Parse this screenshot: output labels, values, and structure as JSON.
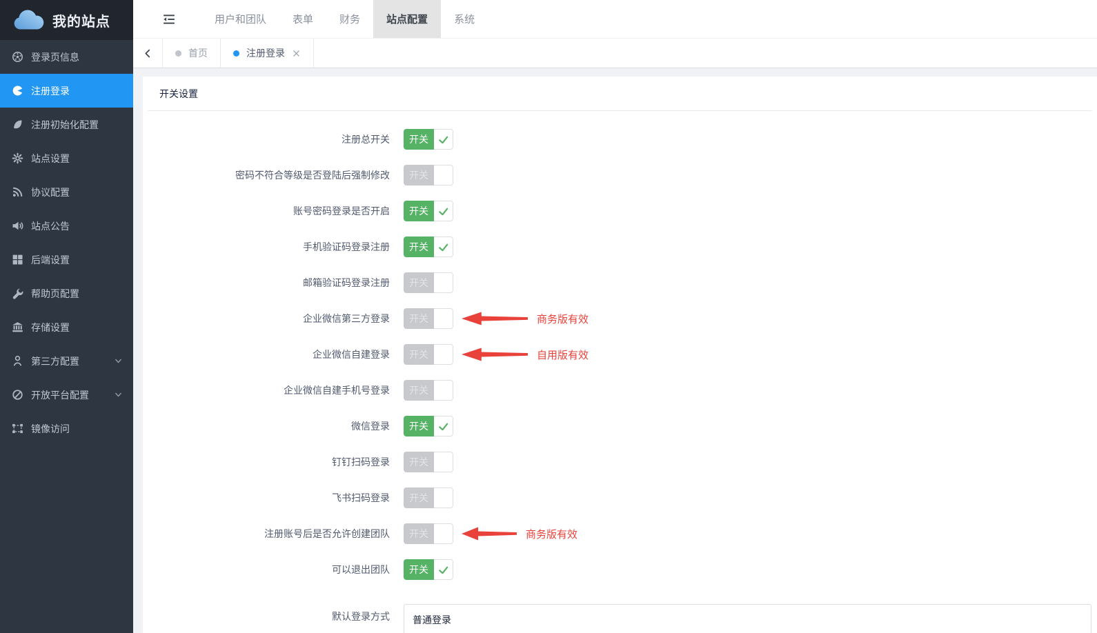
{
  "colors": {
    "accent_blue": "#2196f3",
    "switch_on_green": "#56b366",
    "switch_off_gray": "#c8c9cc",
    "annotation_red": "#e8423a",
    "sidebar_bg": "#2e3642",
    "logo_bg": "#21262e",
    "active_nav_bg": "#e4e4e4"
  },
  "sidebar": {
    "logo": {
      "title": "我的站点",
      "icon": "cloud-logo-icon"
    },
    "items": [
      {
        "name": "login-page-info",
        "label": "登录页信息",
        "icon": "football-icon",
        "active": false
      },
      {
        "name": "register-login",
        "label": "注册登录",
        "icon": "dashboard-icon",
        "active": true
      },
      {
        "name": "register-init-config",
        "label": "注册初始化配置",
        "icon": "leaf-icon",
        "active": false
      },
      {
        "name": "site-settings",
        "label": "站点设置",
        "icon": "gear-icon",
        "active": false
      },
      {
        "name": "protocol-config",
        "label": "协议配置",
        "icon": "rss-icon",
        "active": false
      },
      {
        "name": "site-announcement",
        "label": "站点公告",
        "icon": "speaker-icon",
        "active": false
      },
      {
        "name": "backend-settings",
        "label": "后端设置",
        "icon": "grid-icon",
        "active": false
      },
      {
        "name": "help-page-config",
        "label": "帮助页配置",
        "icon": "wrench-icon",
        "active": false
      },
      {
        "name": "storage-settings",
        "label": "存储设置",
        "icon": "bank-icon",
        "active": false
      },
      {
        "name": "third-party-config",
        "label": "第三方配置",
        "icon": "person-icon",
        "active": false,
        "expandable": true
      },
      {
        "name": "open-platform-config",
        "label": "开放平台配置",
        "icon": "slash-circle-icon",
        "active": false,
        "expandable": true
      },
      {
        "name": "mirror-access",
        "label": "镜像访问",
        "icon": "object-group-icon",
        "active": false
      }
    ]
  },
  "topnav": {
    "items": [
      {
        "name": "users-teams",
        "label": "用户和团队",
        "active": false
      },
      {
        "name": "forms",
        "label": "表单",
        "active": false
      },
      {
        "name": "finance",
        "label": "财务",
        "active": false
      },
      {
        "name": "site-config",
        "label": "站点配置",
        "active": true
      },
      {
        "name": "system",
        "label": "系统",
        "active": false
      }
    ]
  },
  "tabs": [
    {
      "name": "home",
      "label": "首页",
      "active": false,
      "closable": false
    },
    {
      "name": "register-login",
      "label": "注册登录",
      "active": true,
      "closable": true
    }
  ],
  "panel": {
    "title": "开关设置"
  },
  "form": {
    "switch_label": "开关",
    "rows": [
      {
        "name": "register-master-switch",
        "label": "注册总开关",
        "type": "switch",
        "on": true
      },
      {
        "name": "password-force-change",
        "label": "密码不符合等级是否登陆后强制修改",
        "type": "switch",
        "on": false
      },
      {
        "name": "account-password-login",
        "label": "账号密码登录是否开启",
        "type": "switch",
        "on": true
      },
      {
        "name": "phone-code-login",
        "label": "手机验证码登录注册",
        "type": "switch",
        "on": true
      },
      {
        "name": "email-code-login",
        "label": "邮箱验证码登录注册",
        "type": "switch",
        "on": false
      },
      {
        "name": "wecom-third-party-login",
        "label": "企业微信第三方登录",
        "type": "switch",
        "on": false,
        "annotation": {
          "text": "商务版有效",
          "arrow_width": 96
        }
      },
      {
        "name": "wecom-self-built-login",
        "label": "企业微信自建登录",
        "type": "switch",
        "on": false,
        "annotation": {
          "text": "自用版有效",
          "arrow_width": 96
        }
      },
      {
        "name": "wecom-self-built-phone-login",
        "label": "企业微信自建手机号登录",
        "type": "switch",
        "on": false
      },
      {
        "name": "wechat-login",
        "label": "微信登录",
        "type": "switch",
        "on": true
      },
      {
        "name": "dingtalk-scan-login",
        "label": "钉钉扫码登录",
        "type": "switch",
        "on": false
      },
      {
        "name": "feishu-scan-login",
        "label": "飞书扫码登录",
        "type": "switch",
        "on": false
      },
      {
        "name": "allow-create-team",
        "label": "注册账号后是否允许创建团队",
        "type": "switch",
        "on": false,
        "annotation": {
          "text": "商务版有效",
          "arrow_width": 80
        }
      },
      {
        "name": "can-quit-team",
        "label": "可以退出团队",
        "type": "switch",
        "on": true
      },
      {
        "name": "default-login-method",
        "label": "默认登录方式",
        "type": "select",
        "value": "普通登录"
      }
    ]
  }
}
